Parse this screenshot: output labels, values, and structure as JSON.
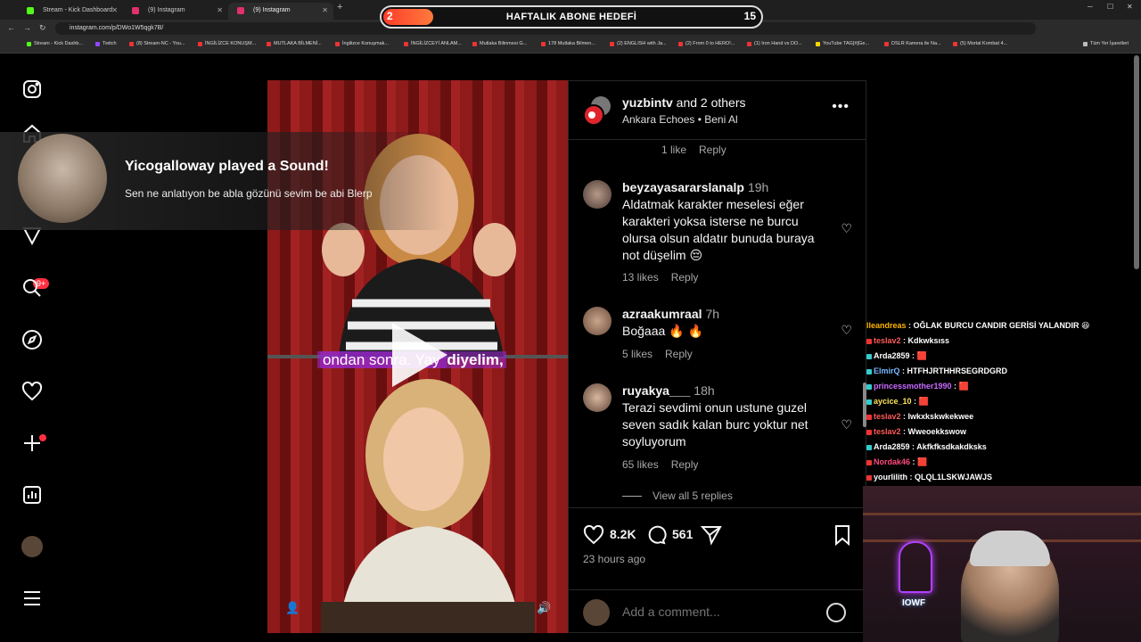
{
  "browser": {
    "tabs": [
      {
        "title": "Stream - Kick Dashboard",
        "color": "#53fc18"
      },
      {
        "title": "(9) Instagram",
        "color": "#e1306c"
      },
      {
        "title": "(9) Instagram",
        "color": "#e1306c"
      }
    ],
    "url": "instagram.com/p/DWo1W5qgk7B/",
    "bookmarks": [
      "Stream - Kick Dashb...",
      "Twitch",
      "(8) Stream-NC - You...",
      "İNGİLİZCE KONUŞM...",
      "MUTLAKA BİLMENİ...",
      "İngilizce Konuşmak...",
      "İNGİLİZCEYİ ANLAM...",
      "Mutlaka Bilinmesi G...",
      "178 Mutlaka Bilmen...",
      "(2) ENGLISH with Ja...",
      "(2) From 0 to HERO!...",
      "(1) Iron Hand vs DO...",
      "YouTube TAG[#]Ge...",
      "DSLR Kamera ile Na...",
      "(5) Mortal Kombat 4...",
      "Tüm Yer İşaretleri"
    ]
  },
  "goal": {
    "current": "2",
    "title": "HAFTALIK ABONE HEDEFİ",
    "target": "15",
    "progress": 0.133
  },
  "nav": {
    "notification_badge": "9+"
  },
  "alert": {
    "title": "Yicogalloway played a Sound!",
    "message": "Sen ne anlatıyon be abla gözünü sevim be abi Blerp"
  },
  "video": {
    "subtitle_plain": "ondan sonra. Yay ",
    "subtitle_bold": "diyelim,"
  },
  "post": {
    "author": "yuzbintv",
    "author_suffix": "and 2 others",
    "audio": "Ankara Echoes • Beni Al",
    "prev_meta": {
      "likes": "1 like",
      "reply": "Reply"
    },
    "comments": [
      {
        "user": "beyzayasararslanalp",
        "time": "19h",
        "text": "Aldatmak karakter meselesi eğer karakteri yoksa isterse ne burcu olursa olsun aldatır bunuda buraya not düşelim 😔",
        "likes": "13 likes",
        "reply": "Reply"
      },
      {
        "user": "azraakumraal",
        "time": "7h",
        "text": "Boğaaa 🔥 🔥",
        "likes": "5 likes",
        "reply": "Reply"
      },
      {
        "user": "ruyakya___",
        "time": "18h",
        "text": "Terazi sevdimi onun ustune guzel seven sadık kalan burc yoktur net soyluyorum",
        "likes": "65 likes",
        "reply": "Reply"
      }
    ],
    "view_replies": "View all 5 replies",
    "like_count": "8.2K",
    "comment_count": "561",
    "posted": "23 hours ago",
    "add_comment_placeholder": "Add a comment..."
  },
  "chat": [
    {
      "user": "lleandreas",
      "msg": "OĞLAK BURCU CANDIR GERİSİ YALANDIR 😆",
      "color": "#ffb400"
    },
    {
      "user": "teslav2",
      "msg": "Kdkwksıss",
      "color": "#ff5a5a"
    },
    {
      "user": "Arda2859",
      "msg": "🟥",
      "color": "#ffffff"
    },
    {
      "user": "ElmirQ",
      "msg": "HTFHJRTHHRSEGRDGRD",
      "color": "#7ab8ff"
    },
    {
      "user": "princessmother1990",
      "msg": "🟥",
      "color": "#c86bff"
    },
    {
      "user": "aycice_10",
      "msg": "🟥",
      "color": "#ffe45a"
    },
    {
      "user": "teslav2",
      "msg": "Iwkxkskwkekwee",
      "color": "#ff5a5a"
    },
    {
      "user": "teslav2",
      "msg": "Wweoekkswow",
      "color": "#ff5a5a"
    },
    {
      "user": "Arda2859",
      "msg": "Akfkfksdkakdksks",
      "color": "#ffffff"
    },
    {
      "user": "Nordak46",
      "msg": "🟥",
      "color": "#ff4a7a"
    },
    {
      "user": "yourlilith",
      "msg": "QLQL1LSKWJAWJS",
      "color": "#ffffff"
    }
  ],
  "webcam": {
    "neon_text": "IOWF"
  }
}
